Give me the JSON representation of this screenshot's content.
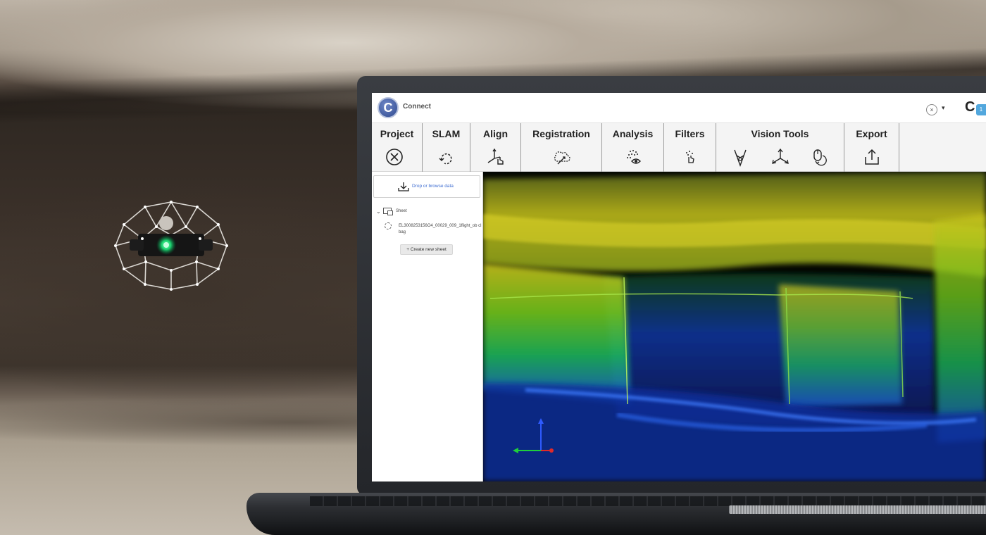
{
  "app": {
    "name": "Connect",
    "logo_letter": "C",
    "brand_letter": "C",
    "badge": "1"
  },
  "titlebar": {
    "close_glyph": "×",
    "dropdown_glyph": "▾"
  },
  "ribbon": {
    "groups": [
      {
        "label": "Project",
        "tools": [
          "close-circle-icon"
        ]
      },
      {
        "label": "SLAM",
        "tools": [
          "loop-cloud-icon"
        ]
      },
      {
        "label": "Align",
        "tools": [
          "axes-hand-icon"
        ]
      },
      {
        "label": "Registration",
        "tools": [
          "cloud-registration-icon"
        ]
      },
      {
        "label": "Analysis",
        "tools": [
          "point-eye-icon"
        ]
      },
      {
        "label": "Filters",
        "tools": [
          "filter-hand-icon"
        ]
      },
      {
        "label": "Vision Tools",
        "tools": [
          "pen-nib-icon",
          "axes-3d-icon",
          "mouse-rotate-icon"
        ]
      },
      {
        "label": "Export",
        "tools": [
          "export-upload-icon"
        ]
      }
    ]
  },
  "panel": {
    "drop_label": "Drop or browse data",
    "sheet_label": "Sheet",
    "file_name": "EL3008253156O4_00029_009_1flight_ob clbag",
    "create_button": "Create new sheet",
    "create_glyph": "+"
  },
  "colors": {
    "brand": "#2f4a8f",
    "link": "#3d6cd1",
    "badge": "#52a7dd"
  }
}
